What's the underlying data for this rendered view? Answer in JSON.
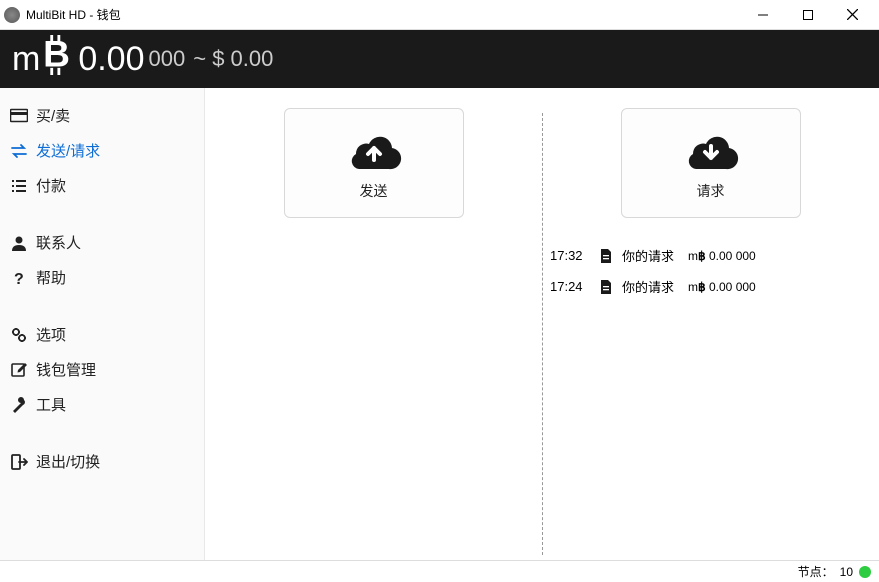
{
  "window": {
    "title": "MultiBit HD - 钱包"
  },
  "balance": {
    "unit_prefix": "m",
    "amount_main": "0.00",
    "amount_decimals": "000",
    "fiat": "~ $ 0.00"
  },
  "sidebar": {
    "buy_sell": "买/卖",
    "send_request": "发送/请求",
    "payments": "付款",
    "contacts": "联系人",
    "help": "帮助",
    "options": "选项",
    "wallet_mgmt": "钱包管理",
    "tools": "工具",
    "exit_switch": "退出/切换"
  },
  "main": {
    "send_label": "发送",
    "request_label": "请求",
    "transactions": [
      {
        "time": "17:32",
        "desc": "你的请求",
        "amount": "0.00 000"
      },
      {
        "time": "17:24",
        "desc": "你的请求",
        "amount": "0.00 000"
      }
    ]
  },
  "status": {
    "nodes_label": "节点：",
    "nodes_count": "10"
  }
}
